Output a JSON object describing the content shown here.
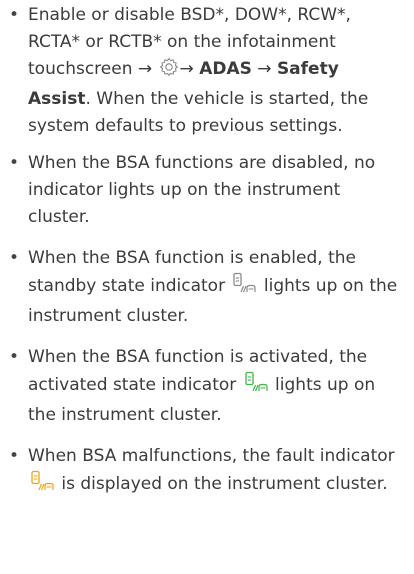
{
  "items": [
    {
      "bullet": "•",
      "text_a": "Enable or disable BSD*, DOW*, RCW*, RCTA* or RCTB* on the infotainment touchscreen ",
      "arrow1": "→",
      "settings_icon": "gear-icon",
      "arrow2": "→",
      "menu1": "ADAS",
      "arrow3": "→",
      "menu2": "Safety Assist",
      "text_b": ". When the vehicle is started, the system defaults to previous settings."
    },
    {
      "bullet": "•",
      "text": "When the BSA functions are disabled, no indicator lights up on the instrument cluster."
    },
    {
      "bullet": "•",
      "text_a": "When the BSA function is enabled, the standby state indicator",
      "icon_name": "bsa-standby-indicator-icon",
      "icon_color": "#8a8a8a",
      "text_b": " lights up on the instrument cluster."
    },
    {
      "bullet": "•",
      "text_a": "When the BSA function is activated, the activated state indicator ",
      "icon_name": "bsa-activated-indicator-icon",
      "icon_color": "#3fb44a",
      "text_b": " lights up on the instrument cluster."
    },
    {
      "bullet": "•",
      "text_a": "When BSA malfunctions, the fault indicator",
      "icon_name": "bsa-fault-indicator-icon",
      "icon_color": "#f0a21a",
      "text_b": " is displayed on the instrument cluster."
    }
  ]
}
